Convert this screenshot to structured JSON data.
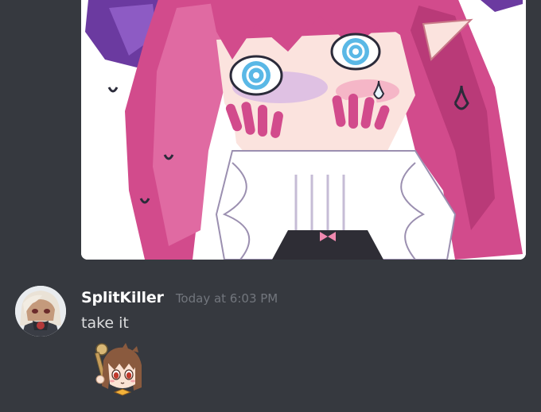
{
  "messages": [
    {
      "author": "SplitKiller",
      "timestamp": "Today at 6:03 PM",
      "content": "take it",
      "avatar_icon": "user-avatar",
      "attachment_icon": "custom-emoji-sticker"
    }
  ],
  "previous_attachment": {
    "icon": "anime-girl-image-attachment"
  },
  "colors": {
    "background": "#36393f",
    "username": "#ffffff",
    "timestamp": "#72767d",
    "message_text": "#dcddde"
  }
}
